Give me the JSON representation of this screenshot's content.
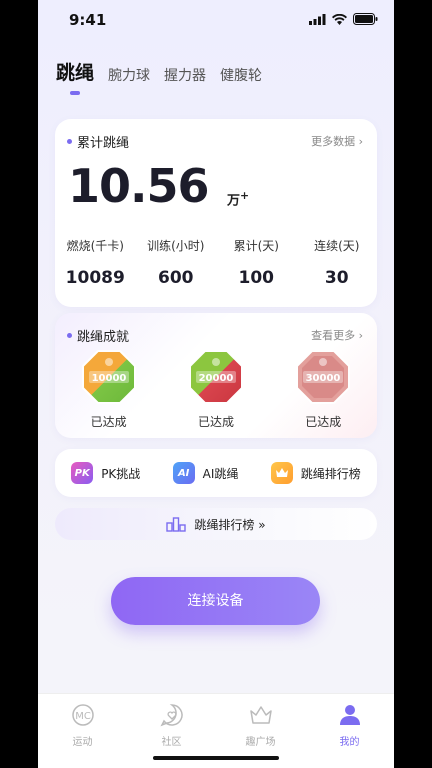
{
  "status": {
    "time": "9:41"
  },
  "tabs": [
    {
      "label": "跳绳",
      "active": true
    },
    {
      "label": "腕力球"
    },
    {
      "label": "握力器"
    },
    {
      "label": "健腹轮"
    }
  ],
  "summary": {
    "title": "累计跳绳",
    "more": "更多数据",
    "total_value": "10.56",
    "total_unit": "万",
    "stats": [
      {
        "label": "燃烧(千卡)",
        "value": "10089"
      },
      {
        "label": "训练(小时)",
        "value": "600"
      },
      {
        "label": "累计(天)",
        "value": "100"
      },
      {
        "label": "连续(天)",
        "value": "30"
      }
    ]
  },
  "achievements": {
    "title": "跳绳成就",
    "more": "查看更多",
    "badges": [
      {
        "text": "10000",
        "label": "已达成",
        "colors": [
          "#f0a03a",
          "#7cc444"
        ]
      },
      {
        "text": "20000",
        "label": "已达成",
        "colors": [
          "#d9444d",
          "#8cc63f"
        ]
      },
      {
        "text": "30000",
        "label": "已达成",
        "colors": [
          "#d98a88",
          "#e9a9a5"
        ]
      }
    ]
  },
  "features": [
    {
      "icon": "PK",
      "label": "PK挑战"
    },
    {
      "icon": "AI",
      "label": "AI跳绳"
    },
    {
      "icon": "crown-icon",
      "label": "跳绳排行榜"
    }
  ],
  "rank_banner": {
    "label": "跳绳排行榜 »"
  },
  "connect_button": "连接设备",
  "nav": [
    {
      "label": "运动",
      "icon": "sport-icon"
    },
    {
      "label": "社区",
      "icon": "community-icon"
    },
    {
      "label": "趣广场",
      "icon": "plaza-icon"
    },
    {
      "label": "我的",
      "icon": "profile-icon",
      "active": true
    }
  ],
  "accent": "#7b6cf0"
}
